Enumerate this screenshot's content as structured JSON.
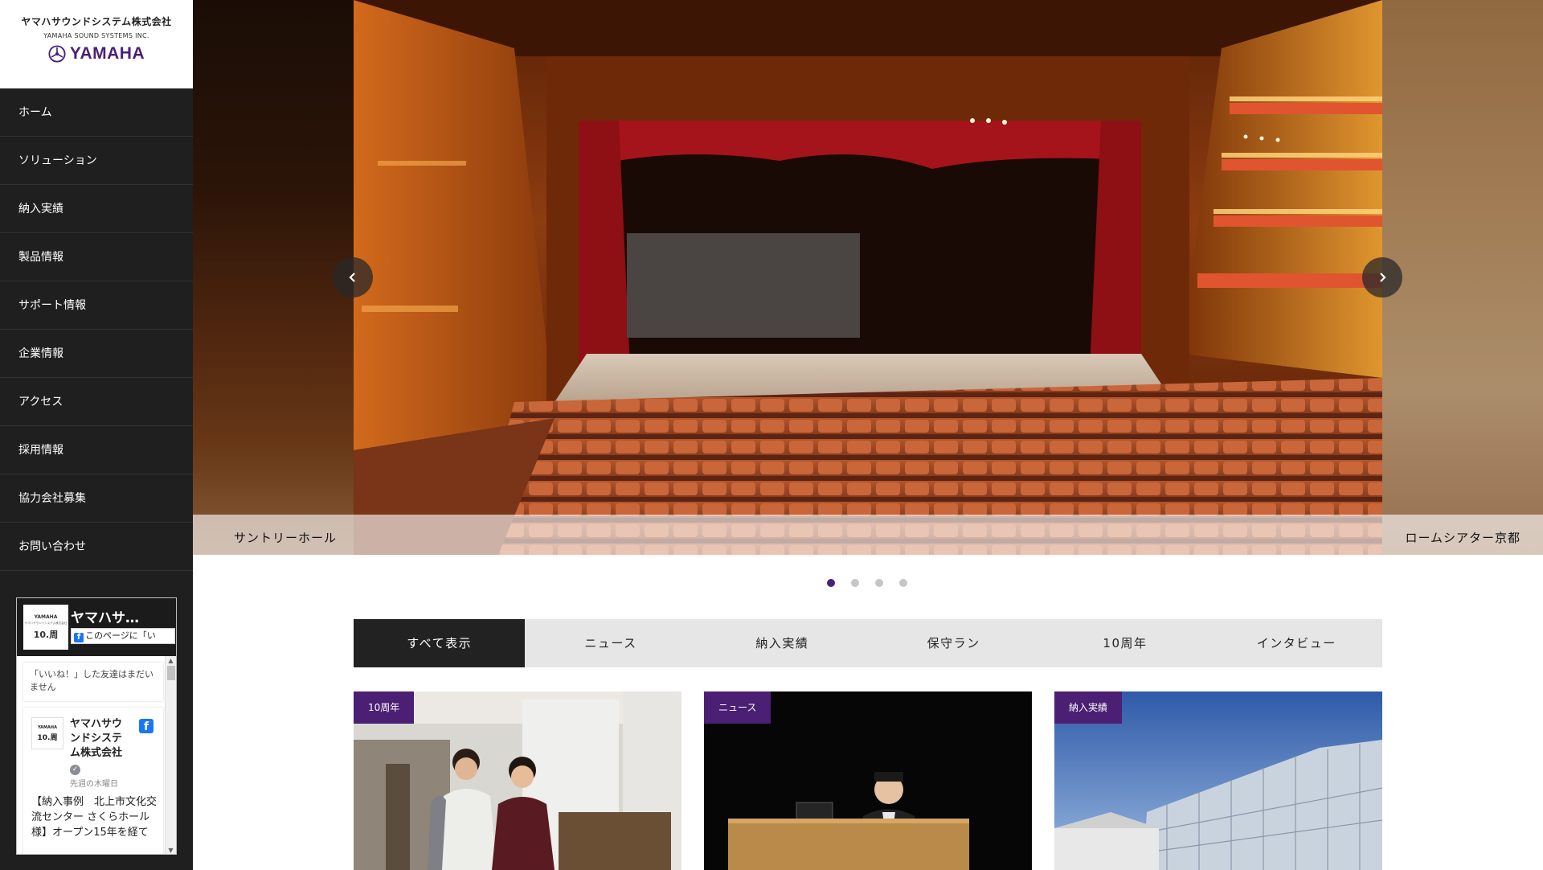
{
  "sidebar": {
    "logo": {
      "company_jp": "ヤマハサウンドシステム株式会社",
      "company_en": "YAMAHA SOUND SYSTEMS INC.",
      "brand": "YAMAHA"
    },
    "nav": [
      {
        "label": "ホーム",
        "icon": ""
      },
      {
        "label": "ソリューション"
      },
      {
        "label": "納入実績"
      },
      {
        "label": "製品情報"
      },
      {
        "label": "サポート情報"
      },
      {
        "label": "企業情報"
      },
      {
        "label": "アクセス"
      },
      {
        "label": "採用情報"
      },
      {
        "label": "協力会社募集"
      },
      {
        "label": "お問い合わせ"
      }
    ],
    "facebook": {
      "page_name": "ヤマハサ…",
      "like_label": "このページに「い",
      "avatar_line1": "YAMAHA",
      "avatar_line2": "ヤマハサウンドシステム株式会社",
      "avatar_line3": "10.周",
      "friends_text": "「いいね！」した友達はまだいません",
      "post_author": "ヤマハサウンドシステム株式会社",
      "post_date": "先週の木曜日",
      "post_text": "【納入事例　北上市文化交流センター さくらホール 様】オープン15年を経て"
    }
  },
  "hero": {
    "caption_left": "サントリーホール",
    "caption_right": "ロームシアター京都",
    "slide_count": 4,
    "active_slide": 1
  },
  "tabs": [
    {
      "label": "すべて表示",
      "active": true
    },
    {
      "label": "ニュース",
      "active": false
    },
    {
      "label": "納入実績",
      "active": false
    },
    {
      "label": "保守ラン",
      "active": false
    },
    {
      "label": "10周年",
      "active": false
    },
    {
      "label": "インタビュー",
      "active": false
    }
  ],
  "cards": [
    {
      "tag": "10周年"
    },
    {
      "tag": "ニュース"
    },
    {
      "tag": "納入実績"
    }
  ],
  "colors": {
    "accent": "#4a1f74",
    "sidebar_bg": "#1f1f1f",
    "tab_bg": "#e6e6e6",
    "tab_active_bg": "#222222"
  }
}
